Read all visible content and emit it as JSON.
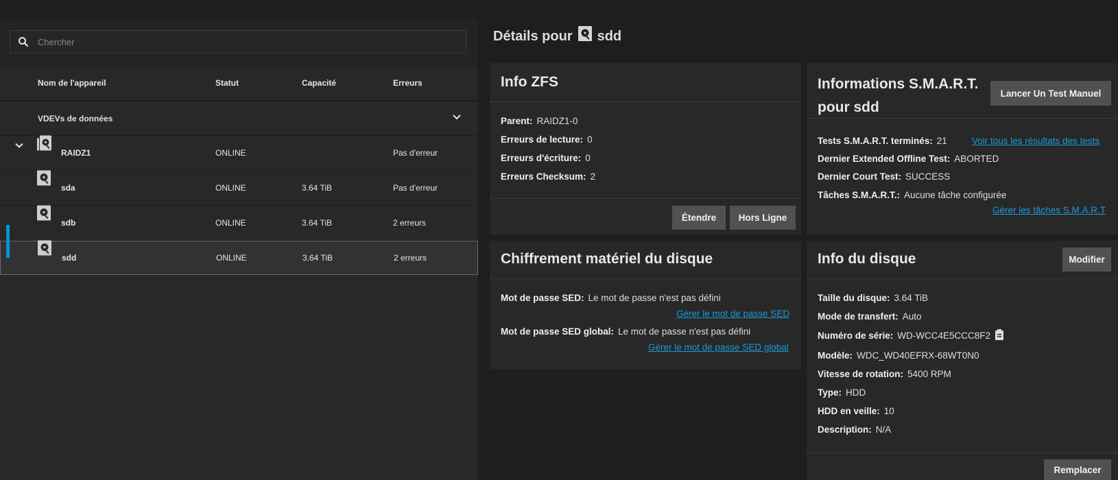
{
  "search": {
    "placeholder": "Chercher"
  },
  "table": {
    "headers": {
      "name": "Nom de l'appareil",
      "status": "Statut",
      "capacity": "Capacité",
      "errors": "Erreurs"
    },
    "group_label": "VDEVs de données",
    "rows": [
      {
        "name": "RAIDZ1",
        "status": "ONLINE",
        "capacity": "",
        "errors": "Pas d'erreur"
      },
      {
        "name": "sda",
        "status": "ONLINE",
        "capacity": "3.64 TiB",
        "errors": "Pas d'erreur"
      },
      {
        "name": "sdb",
        "status": "ONLINE",
        "capacity": "3.64 TiB",
        "errors": "2 erreurs"
      },
      {
        "name": "sdd",
        "status": "ONLINE",
        "capacity": "3.64 TiB",
        "errors": "2 erreurs"
      }
    ]
  },
  "details": {
    "title_prefix": "Détails pour",
    "disk": "sdd"
  },
  "zfs": {
    "title": "Info ZFS",
    "items": [
      {
        "label": "Parent:",
        "value": "RAIDZ1-0"
      },
      {
        "label": "Erreurs de lecture:",
        "value": "0"
      },
      {
        "label": "Erreurs d'écriture:",
        "value": "0"
      },
      {
        "label": "Erreurs Checksum:",
        "value": "2"
      }
    ],
    "btn_extend": "Étendre",
    "btn_offline": "Hors Ligne"
  },
  "smart": {
    "title": "Informations S.M.A.R.T. pour sdd",
    "title_line1": "Informations S.M.A.R.T.",
    "title_line2": "pour sdd",
    "btn_manual": "Lancer Un Test Manuel",
    "items": [
      {
        "label": "Tests S.M.A.R.T. terminés:",
        "value": "21"
      },
      {
        "label": "Dernier Extended Offline Test:",
        "value": "ABORTED"
      },
      {
        "label": "Dernier Court Test:",
        "value": "SUCCESS"
      },
      {
        "label": "Tâches S.M.A.R.T.:",
        "value": "Aucune tâche configurée"
      }
    ],
    "link_results": "Voir tous les résultats des tests",
    "link_tasks": "Gérer les tâches S.M.A.R.T"
  },
  "sed": {
    "title": "Chiffrement matériel du disque",
    "items": [
      {
        "label": "Mot de passe SED:",
        "value": "Le mot de passe n'est pas défini"
      },
      {
        "label": "Mot de passe SED global:",
        "value": "Le mot de passe n'est pas défini"
      }
    ],
    "link_sed": "Gérer le mot de passe SED",
    "link_sed_global": "Gérer le mot de passe SED global"
  },
  "disk": {
    "title": "Info du disque",
    "btn_edit": "Modifier",
    "items": [
      {
        "label": "Taille du disque:",
        "value": "3.64 TiB"
      },
      {
        "label": "Mode de transfert:",
        "value": "Auto"
      },
      {
        "label": "Numéro de série:",
        "value": "WD-WCC4E5CCC8F2"
      },
      {
        "label": "Modèle:",
        "value": "WDC_WD40EFRX-68WT0N0"
      },
      {
        "label": "Vitesse de rotation:",
        "value": "5400 RPM"
      },
      {
        "label": "Type:",
        "value": "HDD"
      },
      {
        "label": "HDD en veille:",
        "value": "10"
      },
      {
        "label": "Description:",
        "value": "N/A"
      }
    ],
    "btn_replace": "Remplacer"
  }
}
